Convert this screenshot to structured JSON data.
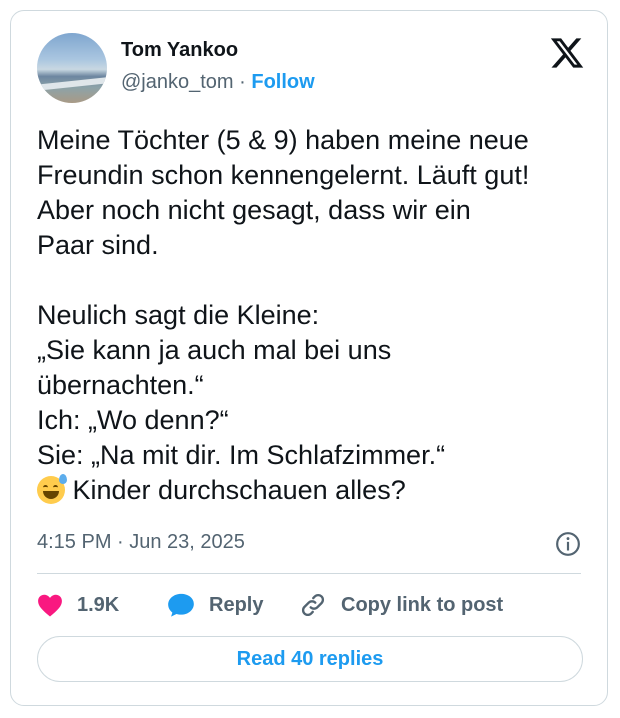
{
  "author": {
    "name": "Tom Yankoo",
    "handle": "@janko_tom",
    "separator": "·",
    "follow_label": "Follow"
  },
  "tweet": {
    "lines_before_emoji": "Meine Töchter (5 & 9) haben meine neue\nFreundin schon kennengelernt. Läuft gut!\nAber noch nicht gesagt, dass wir ein\nPaar sind.\n\nNeulich sagt die Kleine:\n„Sie kann ja auch mal bei uns\nübernachten.“\nIch: „Wo denn?“\nSie: „Na mit dir. Im Schlafzimmer.“\n",
    "emoji": "grinning-face-with-sweat",
    "last_line": " Kinder durchschauen alles?"
  },
  "meta": {
    "timestamp": "4:15 PM · Jun 23, 2025"
  },
  "actions": {
    "like_count": "1.9K",
    "reply_label": "Reply",
    "copy_label": "Copy link to post",
    "read_replies_label": "Read 40 replies"
  },
  "colors": {
    "accent": "#1d9bf0",
    "like": "#f91880",
    "muted": "#536471",
    "border": "#cfd9de"
  },
  "icons": [
    "x-logo-icon",
    "info-icon",
    "heart-icon",
    "reply-bubble-icon",
    "link-icon"
  ]
}
